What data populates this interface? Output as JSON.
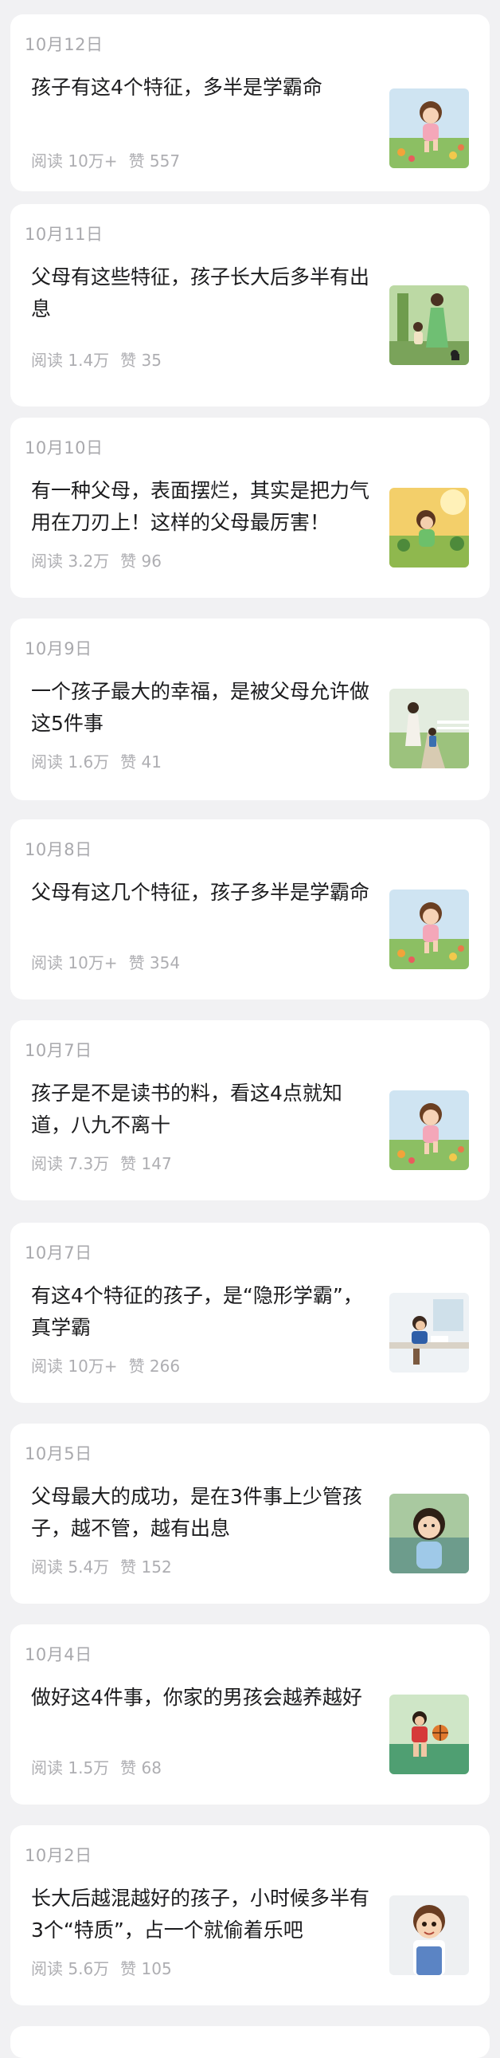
{
  "articles": [
    {
      "date": "10月12日",
      "title": "孩子有这4个特征，多半是学霸命",
      "reads": "阅读 10万+",
      "likes": "赞 557",
      "thumb": "girl-running-flowers"
    },
    {
      "date": "10月11日",
      "title": "父母有这些特征，孩子长大后多半有出息",
      "reads": "阅读 1.4万",
      "likes": "赞 35",
      "thumb": "mother-child-walking"
    },
    {
      "date": "10月10日",
      "title": "有一种父母，表面摆烂，其实是把力气用在刀刃上！这样的父母最厉害！",
      "reads": "阅读 3.2万",
      "likes": "赞 96",
      "thumb": "girl-in-garden"
    },
    {
      "date": "10月9日",
      "title": "一个孩子最大的幸福，是被父母允许做这5件事",
      "reads": "阅读 1.6万",
      "likes": "赞 41",
      "thumb": "mother-child-path"
    },
    {
      "date": "10月8日",
      "title": "父母有这几个特征，孩子多半是学霸命",
      "reads": "阅读 10万+",
      "likes": "赞 354",
      "thumb": "girl-running-flowers"
    },
    {
      "date": "10月7日",
      "title": "孩子是不是读书的料，看这4点就知道，八九不离十",
      "reads": "阅读 7.3万",
      "likes": "赞 147",
      "thumb": "girl-running-flowers"
    },
    {
      "date": "10月7日",
      "title": "有这4个特征的孩子，是“隐形学霸”，真学霸",
      "reads": "阅读 10万+",
      "likes": "赞 266",
      "thumb": "boy-studying-desk"
    },
    {
      "date": "10月5日",
      "title": "父母最大的成功，是在3件事上少管孩子，越不管，越有出息",
      "reads": "阅读 5.4万",
      "likes": "赞 152",
      "thumb": "girl-smiling-lake"
    },
    {
      "date": "10月4日",
      "title": "做好这4件事，你家的男孩会越养越好",
      "reads": "阅读 1.5万",
      "likes": "赞 68",
      "thumb": "boy-basketball"
    },
    {
      "date": "10月2日",
      "title": "长大后越混越好的孩子，小时候多半有3个“特质”，占一个就偷着乐吧",
      "reads": "阅读 5.6万",
      "likes": "赞 105",
      "thumb": "cartoon-boy-overalls"
    }
  ]
}
